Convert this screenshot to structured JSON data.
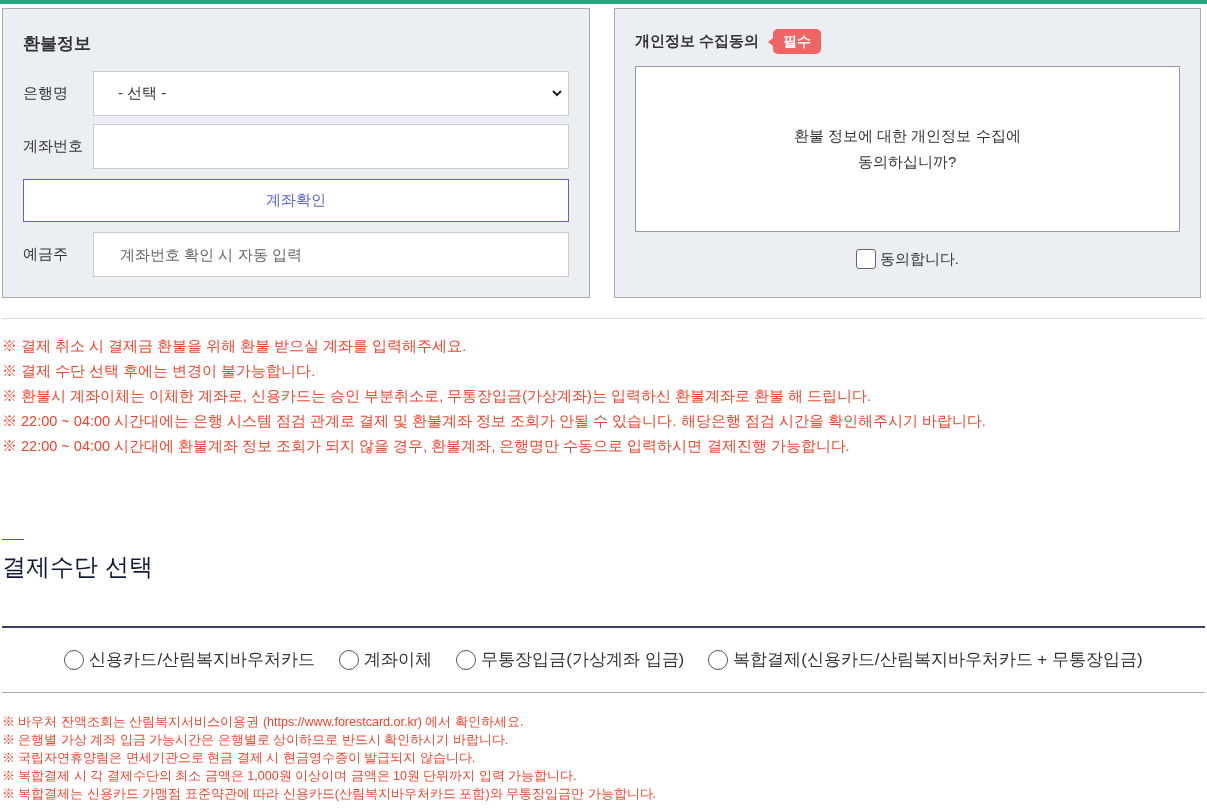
{
  "refund_info": {
    "title": "환불정보",
    "bank": {
      "label": "은행명",
      "value": "- 선택 -"
    },
    "account": {
      "label": "계좌번호"
    },
    "verify_button": "계좌확인",
    "holder": {
      "label": "예금주",
      "placeholder": "계좌번호 확인 시 자동 입력"
    }
  },
  "privacy_consent": {
    "title": "개인정보 수집동의",
    "badge": "필수",
    "message_lines": [
      "환불 정보에 대한 개인정보 수집에",
      "동의하십니까?"
    ],
    "agree": {
      "label": "동의합니다.",
      "checked": false
    }
  },
  "notices": [
    "※ 결제 취소 시 결제금 환불을 위해 환불 받으실 계좌를 입력해주세요.",
    "※ 결제 수단 선택 후에는 변경이 불가능합니다.",
    "※ 환불시 계좌이체는 이체한 계좌로, 신용카드는 승인 부분취소로, 무통장입금(가상계좌)는 입력하신 환불계좌로 환불 해 드립니다.",
    "※ 22:00 ~ 04:00 시간대에는 은행 시스템 점검 관계로 결제 및 환불계좌 정보 조회가 안될 수 있습니다. 해당은행 점검 시간을 확인해주시기 바랍니다.",
    "※ 22:00 ~ 04:00 시간대에 환불계좌 정보 조회가 되지 않을 경우, 환불계좌, 은행명만 수동으로 입력하시면 결제진행 가능합니다."
  ],
  "payment": {
    "title": "결제수단 선택",
    "options": [
      {
        "label": "신용카드/산림복지바우처카드",
        "selected": false
      },
      {
        "label": "계좌이체",
        "selected": false
      },
      {
        "label": "무통장입금(가상계좌 입금)",
        "selected": false
      },
      {
        "label": "복합결제(신용카드/산림복지바우처카드 + 무통장입금)",
        "selected": false
      }
    ],
    "notes": [
      "※ 바우처 잔액조회는 산림복지서비스이용권 (https://www.forestcard.or.kr) 에서 확인하세요.",
      "※ 은행별 가상 계좌 입금 가능시간은 은행별로 상이하므로 반드시 확인하시기 바랍니다.",
      "※ 국립자연휴양림은 면세기관으로 현금 결제 시 현금영수증이 발급되지 않습니다.",
      "※ 복합결제 시 각 결제수단의 최소 금액은 1,000원 이상이며 금액은 10원 단위까지 입력 가능합니다.",
      "※ 복합결제는 신용카드 가맹점 표준약관에 따라 신용카드(산림복지바우처카드 포함)와 무통장입금만 가능합니다."
    ]
  }
}
